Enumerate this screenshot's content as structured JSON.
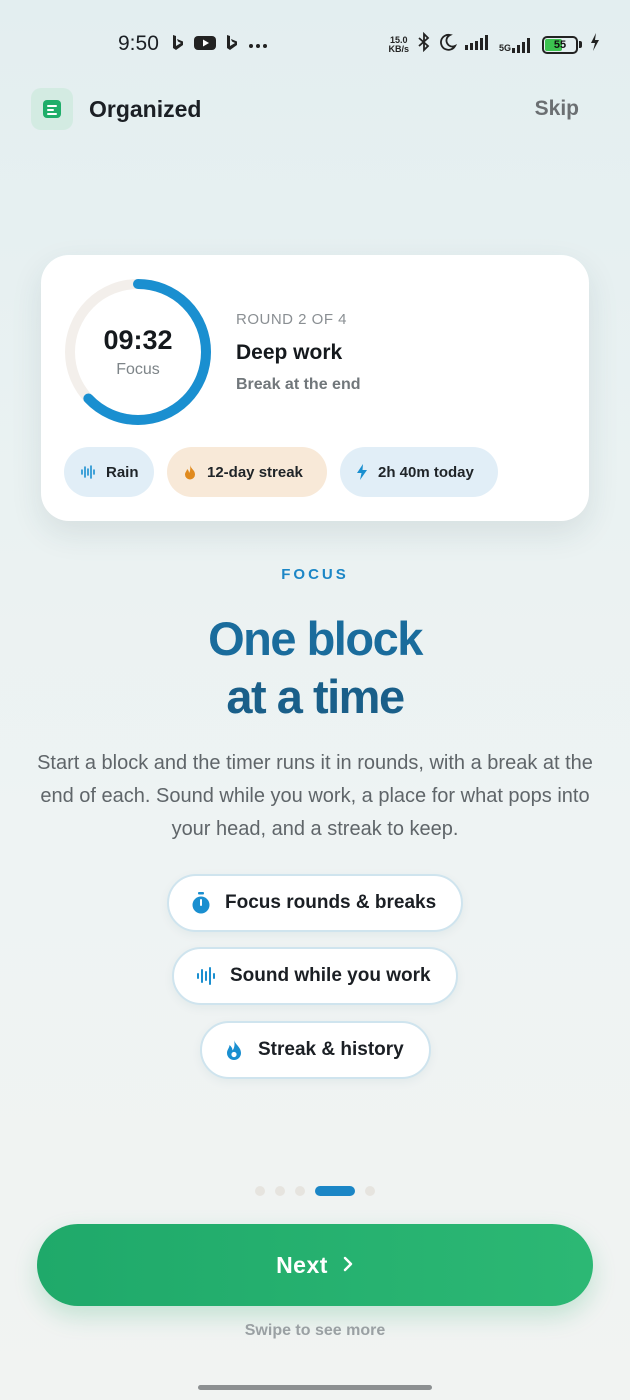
{
  "status_bar": {
    "time": "9:50",
    "left_icons": [
      "bing-icon",
      "youtube-icon",
      "bing-icon",
      "more-dots-icon"
    ],
    "net_speed_value": "15.0",
    "net_speed_unit": "KB/s",
    "right_icons": [
      "bluetooth-icon",
      "do-not-disturb-moon-icon",
      "signal-icon",
      "5g-signal-icon"
    ],
    "network": "5G",
    "battery_level": "55"
  },
  "header": {
    "app_name": "Organized",
    "skip_label": "Skip"
  },
  "session_card": {
    "timer": "09:32",
    "timer_label": "Focus",
    "progress": 0.63,
    "round_label": "ROUND 2 OF 4",
    "title": "Deep work",
    "subtitle": "Break at the end",
    "chips": [
      {
        "label": "Rain",
        "icon": "sound-wave-icon"
      },
      {
        "label": "12-day streak",
        "icon": "flame-icon"
      },
      {
        "label": "2h 40m today",
        "icon": "lightning-icon"
      }
    ]
  },
  "onboarding": {
    "eyebrow": "FOCUS",
    "headline_line1": "One block",
    "headline_line2": "at a time",
    "description": "Start a block and the timer runs it in rounds, with a break at the end of each. Sound while you work, a place for what pops into your head, and a streak to keep.",
    "features": [
      {
        "label": "Focus rounds & breaks",
        "icon": "stopwatch-icon"
      },
      {
        "label": "Sound while you work",
        "icon": "sound-wave-icon"
      },
      {
        "label": "Streak & history",
        "icon": "flame-icon"
      }
    ]
  },
  "pager": {
    "total": 5,
    "active_index": 3
  },
  "next_label": "Next",
  "swipe_hint": "Swipe to see more",
  "colors": {
    "accent_blue": "#1b86c6",
    "primary_green": "#1fa96a",
    "streak_orange": "#e08a1e"
  }
}
